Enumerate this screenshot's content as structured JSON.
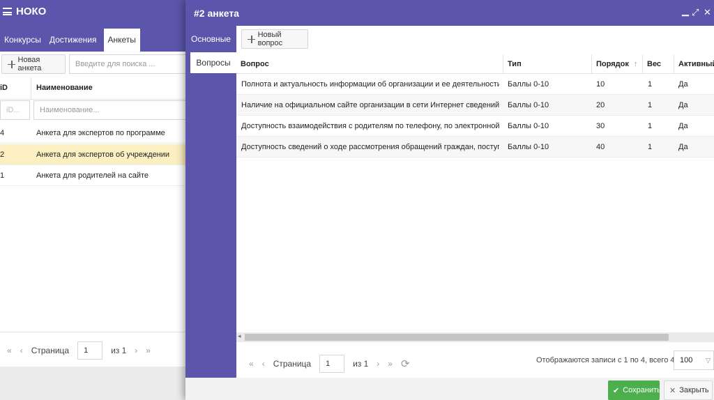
{
  "app": {
    "title": "НОКО",
    "tabs": [
      {
        "label": "Конкурсы"
      },
      {
        "label": "Достижения"
      },
      {
        "label": "Анкеты"
      }
    ],
    "new_button": "Новая анкета",
    "search_placeholder": "Введите для поиска ...",
    "columns": {
      "id": "iD",
      "name": "Наименование"
    },
    "filter": {
      "id_placeholder": "iD...",
      "name_placeholder": "Наименование..."
    },
    "rows": [
      {
        "id": "4",
        "name": "Анкета для экспертов по программе"
      },
      {
        "id": "2",
        "name": "Анкета для экспертов об учреждении",
        "selected": true
      },
      {
        "id": "1",
        "name": "Анкета для родителей на сайте"
      }
    ],
    "pager": {
      "page_label": "Страница",
      "page": "1",
      "of": "из 1"
    }
  },
  "modal": {
    "title": "#2 анкета",
    "side": [
      {
        "label": "Основные"
      },
      {
        "label": "Вопросы"
      }
    ],
    "new_button": "Новый вопрос",
    "columns": {
      "question": "Вопрос",
      "type": "Тип",
      "order": "Порядок",
      "weight": "Вес",
      "active": "Активный"
    },
    "rows": [
      {
        "question": "Полнота и актуальность информации об организации и ее деятельности, р...",
        "type": "Баллы 0-10",
        "order": "10",
        "weight": "1",
        "active": "Да"
      },
      {
        "question": "Наличие на официальном сайте организации в сети Интернет сведений о ...",
        "type": "Баллы 0-10",
        "order": "20",
        "weight": "1",
        "active": "Да"
      },
      {
        "question": "Доступность взаимодействия с родителям по телефону, по электронной по...",
        "type": "Баллы 0-10",
        "order": "30",
        "weight": "1",
        "active": "Да"
      },
      {
        "question": "Доступность сведений о ходе рассмотрения обращений граждан, поступив...",
        "type": "Баллы 0-10",
        "order": "40",
        "weight": "1",
        "active": "Да"
      }
    ],
    "pager": {
      "page_label": "Страница",
      "page": "1",
      "of": "из 1",
      "records": "Отображаются записи с 1 по 4, всего 4",
      "page_size": "100"
    },
    "footer": {
      "save": "Сохранить",
      "close": "Закрыть"
    },
    "colors": {
      "accent": "#5b55ab",
      "save": "#4cae4c"
    }
  }
}
